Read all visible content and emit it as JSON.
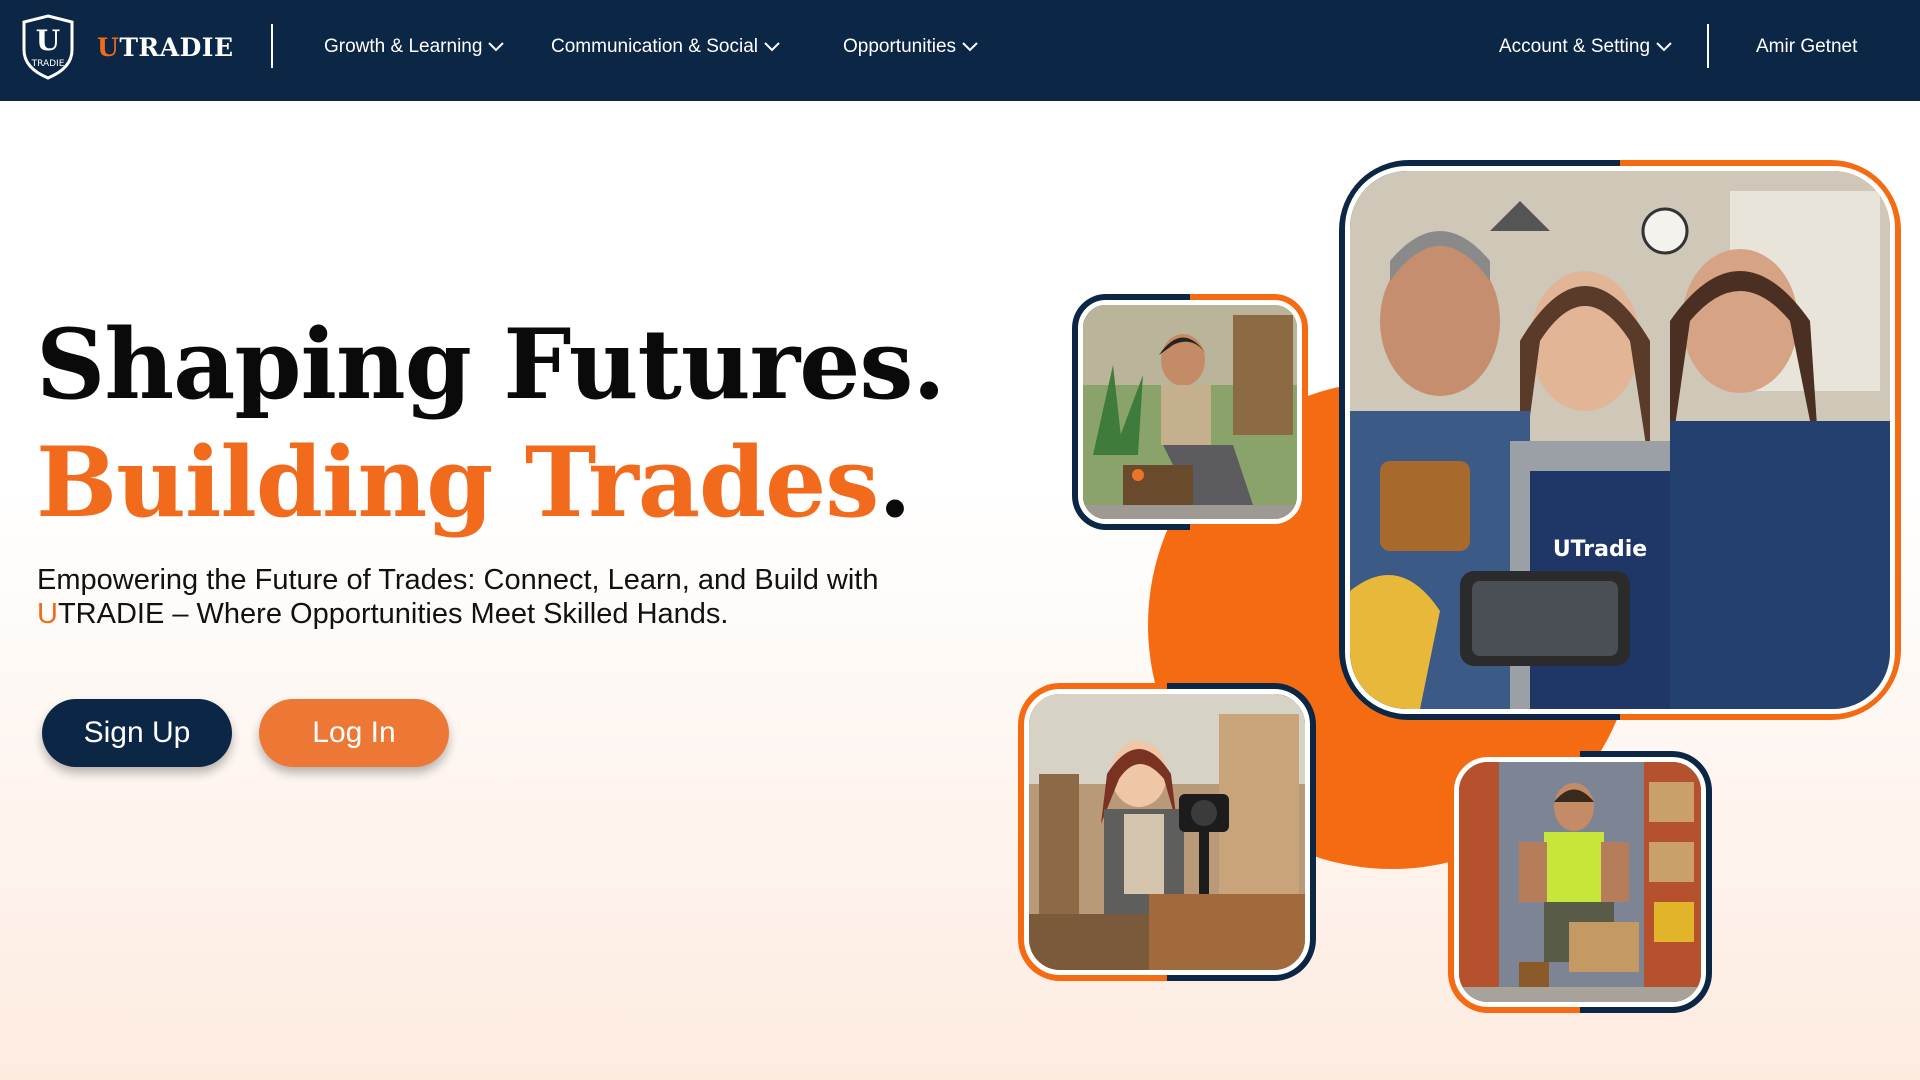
{
  "brand": {
    "name_accent": "U",
    "name_rest": "TRADIE",
    "logo_letter": "U",
    "logo_text": "TRADIE"
  },
  "nav": {
    "items": [
      {
        "label": "Growth & Learning",
        "icon": "chevron-down-icon"
      },
      {
        "label": "Communication & Social",
        "icon": "chevron-down-icon"
      },
      {
        "label": "Opportunities",
        "icon": "chevron-down-icon"
      }
    ],
    "account": {
      "label": "Account & Setting",
      "icon": "chevron-down-icon"
    },
    "user_name": "Amir Getnet"
  },
  "hero": {
    "line1": "Shaping Futures.",
    "line2": "Building Trades",
    "line2_period": ".",
    "tagline_before": "Empowering the Future of Trades: Connect, Learn, and Build with ",
    "tagline_accent": "U",
    "tagline_after": "TRADIE – Where Opportunities Meet Skilled Hands.",
    "signup_label": "Sign Up",
    "login_label": "Log In"
  },
  "photos": {
    "main_shirt_text": "UTradie"
  },
  "colors": {
    "navy": "#0b2745",
    "orange": "#f26a1b",
    "login_orange": "#ed7734"
  }
}
